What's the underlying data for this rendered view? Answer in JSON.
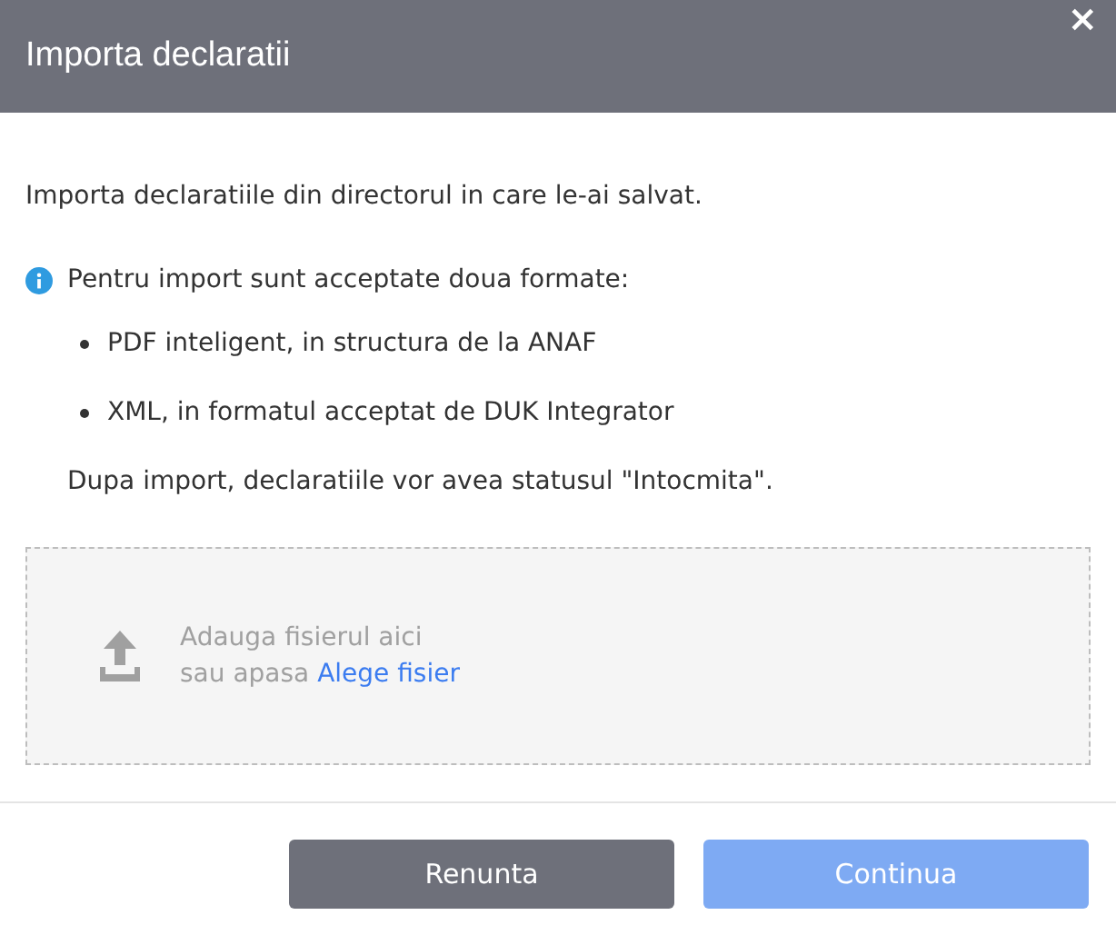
{
  "dialog": {
    "title": "Importa declaratii",
    "close": "×"
  },
  "intro": "Importa declaratiile din directorul in care le-ai salvat.",
  "info": {
    "text": "Pentru import sunt acceptate doua formate:",
    "bullets": [
      "PDF inteligent, in structura de la ANAF",
      "XML, in formatul acceptat de DUK Integrator"
    ],
    "note": "Dupa import, declaratiile vor avea statusul \"Intocmita\"."
  },
  "dropzone": {
    "line1": "Adauga fisierul aici",
    "line2": "sau apasa",
    "link": "Alege fisier"
  },
  "buttons": [
    {
      "label": "Renunta",
      "kind": "secondary",
      "disabled": false
    },
    {
      "label": "Continua",
      "kind": "primary",
      "disabled": true
    }
  ]
}
